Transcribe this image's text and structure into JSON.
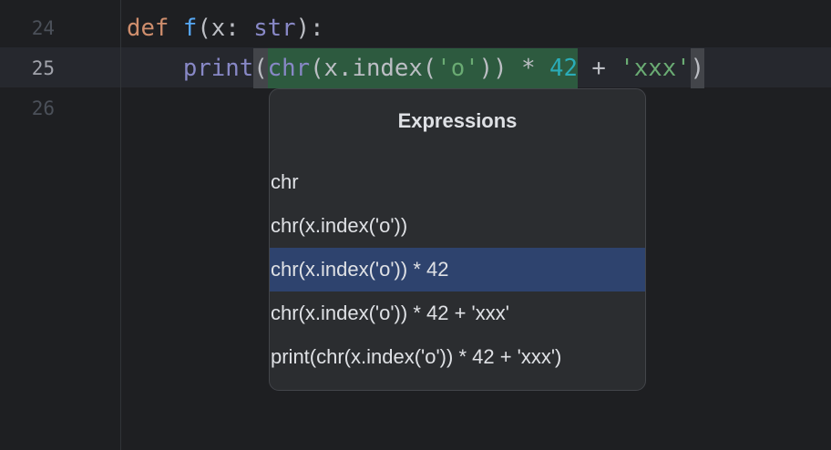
{
  "editor": {
    "line_numbers": [
      "24",
      "25",
      "26"
    ],
    "line24": {
      "kw": "def",
      "space": " ",
      "fn": "f",
      "rest1": "(x: ",
      "type": "str",
      "rest2": "):"
    },
    "line25": {
      "indent": "    ",
      "print": "print",
      "open": "(",
      "chr": "chr",
      "mid": "(x.index(",
      "s1": "'o'",
      "close": ")) * ",
      "num": "42",
      "plus": " + ",
      "s2": "'xxx'",
      "end": ")"
    }
  },
  "popup": {
    "title": "Expressions",
    "items": [
      {
        "label": "chr"
      },
      {
        "label": "chr(x.index('o'))"
      },
      {
        "label": "chr(x.index('o')) * 42"
      },
      {
        "label": "chr(x.index('o')) * 42 + 'xxx'"
      },
      {
        "label": "print(chr(x.index('o')) * 42 + 'xxx')"
      }
    ],
    "selected_index": 2
  }
}
